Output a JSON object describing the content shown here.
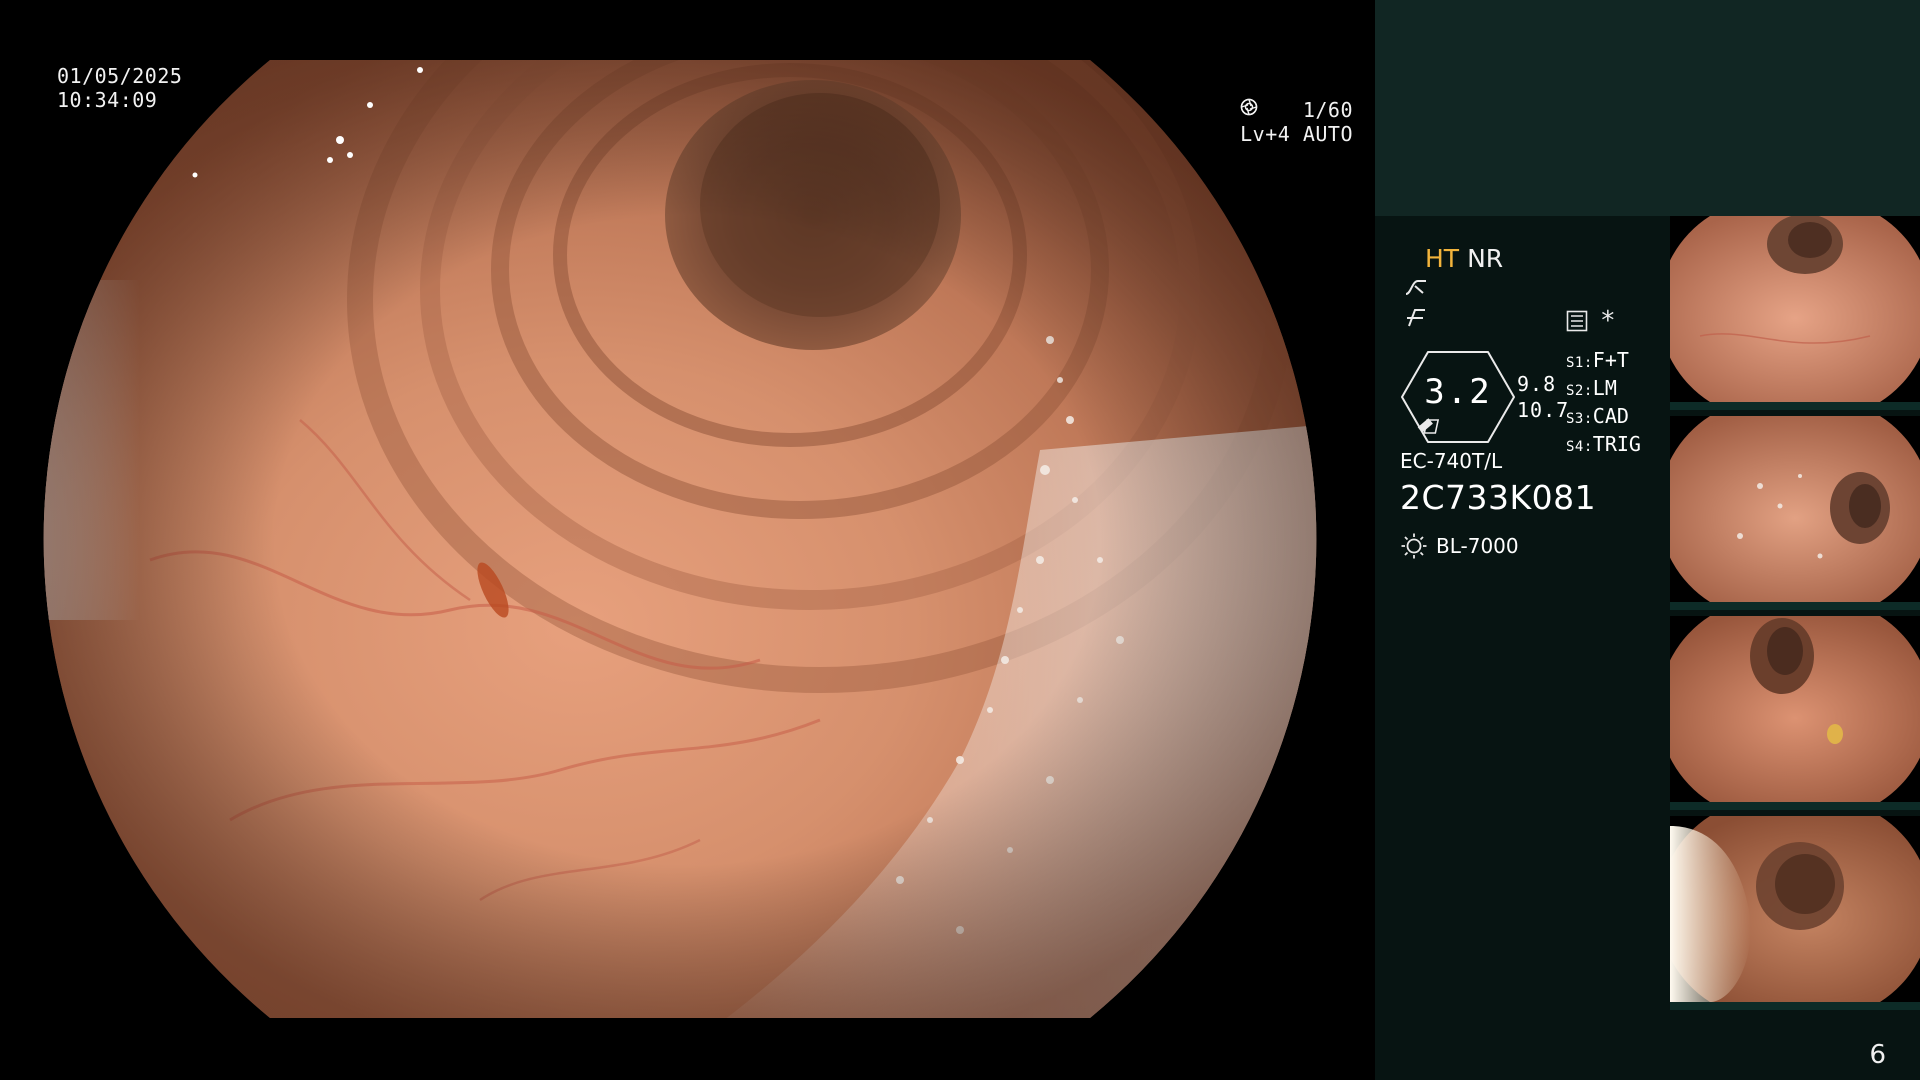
{
  "osd": {
    "date": "01/05/2025",
    "time": "10:34:09",
    "shutter": "1/60",
    "level": "Lv+4 AUTO",
    "shutter_icon": "aperture-icon",
    "auto_icon": "iris-icon"
  },
  "panel": {
    "mode_ht": "HT",
    "mode_nr": "NR",
    "glyph1_icon": "tone-curve-icon",
    "glyph2_icon": "enhance-icon",
    "menu_icon": "settings-list-icon",
    "asterisk": "*",
    "gauge_value": "3.2",
    "side_values": [
      "9.8",
      "10.7"
    ],
    "switches": [
      {
        "key": "S1:",
        "label": "F+T"
      },
      {
        "key": "S2:",
        "label": "LM"
      },
      {
        "key": "S3:",
        "label": "CAD"
      },
      {
        "key": "S4:",
        "label": "TRIG"
      }
    ],
    "scope_model": "EC-740T/L",
    "scope_serial": "2C733K081",
    "light_icon": "lightsource-icon",
    "light_source": "BL-7000",
    "page_number": "6"
  },
  "colors": {
    "panel_bg": "#071412",
    "panel_head_bg": "#112623",
    "ht_accent": "#f2b43c"
  }
}
